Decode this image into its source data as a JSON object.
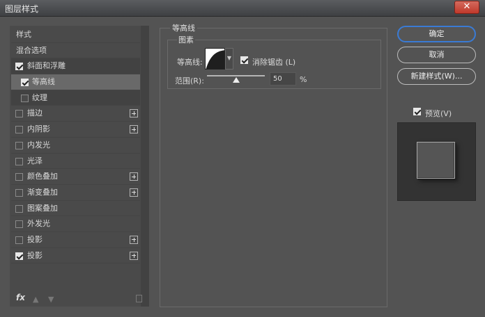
{
  "window": {
    "title": "图层样式",
    "close_label": "✕"
  },
  "sidebar": {
    "items": [
      {
        "label": "样式",
        "checkbox": false,
        "checked": false,
        "plus": false
      },
      {
        "label": "混合选项",
        "checkbox": false,
        "checked": false,
        "plus": false
      },
      {
        "label": "斜面和浮雕",
        "checkbox": true,
        "checked": true,
        "plus": false
      },
      {
        "label": "等高线",
        "checkbox": true,
        "checked": true,
        "plus": false,
        "sub": true
      },
      {
        "label": "纹理",
        "checkbox": true,
        "checked": false,
        "plus": false,
        "sub": true
      },
      {
        "label": "描边",
        "checkbox": true,
        "checked": false,
        "plus": true
      },
      {
        "label": "内阴影",
        "checkbox": true,
        "checked": false,
        "plus": true
      },
      {
        "label": "内发光",
        "checkbox": true,
        "checked": false,
        "plus": false
      },
      {
        "label": "光泽",
        "checkbox": true,
        "checked": false,
        "plus": false
      },
      {
        "label": "颜色叠加",
        "checkbox": true,
        "checked": false,
        "plus": true
      },
      {
        "label": "渐变叠加",
        "checkbox": true,
        "checked": false,
        "plus": true
      },
      {
        "label": "图案叠加",
        "checkbox": true,
        "checked": false,
        "plus": false
      },
      {
        "label": "外发光",
        "checkbox": true,
        "checked": false,
        "plus": false
      },
      {
        "label": "投影",
        "checkbox": true,
        "checked": false,
        "plus": true
      },
      {
        "label": "投影",
        "checkbox": true,
        "checked": true,
        "plus": true
      }
    ],
    "fx_label": "fx"
  },
  "contour_panel": {
    "title": "等高线",
    "section": "图素",
    "contour_label": "等高线:",
    "antialias_label": "消除锯齿 (L)",
    "antialias_checked": true,
    "range_label": "范围(R):",
    "range_value": "50",
    "range_fraction": 0.5,
    "range_unit": "%"
  },
  "actions": {
    "ok": "确定",
    "cancel": "取消",
    "new_style": "新建样式(W)...",
    "preview_label": "预览(V)",
    "preview_checked": true
  },
  "colors": {
    "accent": "#3a7bd5",
    "close": "#c0392b"
  }
}
